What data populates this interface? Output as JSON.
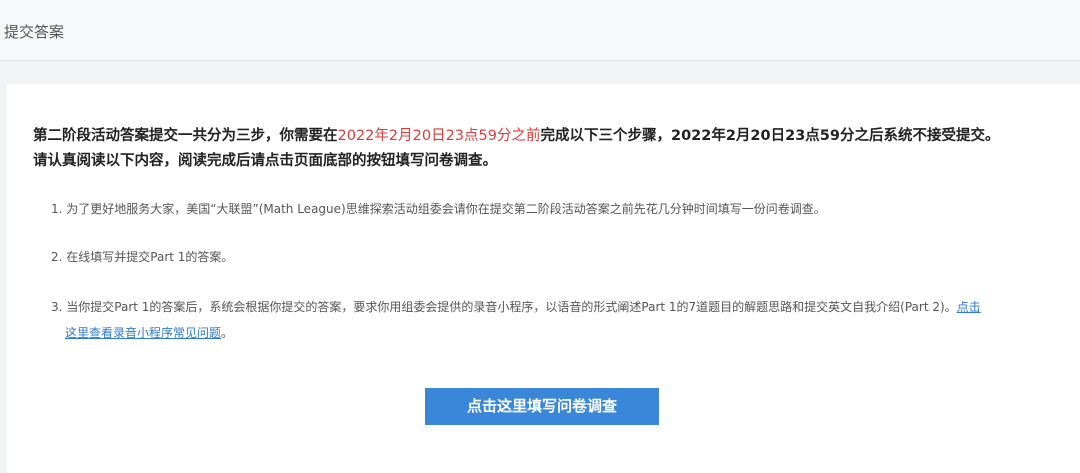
{
  "header": {
    "title": "提交答案"
  },
  "intro": {
    "line1_prefix": "第二阶段活动答案提交一共分为三步，你需要在",
    "deadline_highlight": "2022年2月20日23点59分之前",
    "line1_suffix": "完成以下三个步骤，2022年2月20日23点59分之后系统不接受提交。",
    "line2": "请认真阅读以下内容，阅读完成后请点击页面底部的按钮填写问卷调查。"
  },
  "steps": [
    {
      "text": "1. 为了更好地服务大家，美国“大联盟”(Math League)思维探索活动组委会请你在提交第二阶段活动答案之前先花几分钟时间填写一份问卷调查。"
    },
    {
      "text": "2. 在线填写并提交Part 1的答案。"
    },
    {
      "text": "3. 当你提交Part 1的答案后，系统会根据你提交的答案，要求你用组委会提供的录音小程序，以语音的形式阐述Part 1的7道题目的解题思路和提交英文自我介绍(Part 2)。",
      "link_part1": "点击",
      "link_part2": "这里查看录音小程序常见问题",
      "suffix": "。"
    }
  ],
  "survey_button": {
    "label": "点击这里填写问卷调查"
  },
  "colors": {
    "accent_button": "#3a86d8",
    "deadline_red": "#e03a3a",
    "link_blue": "#2f7ad1"
  }
}
